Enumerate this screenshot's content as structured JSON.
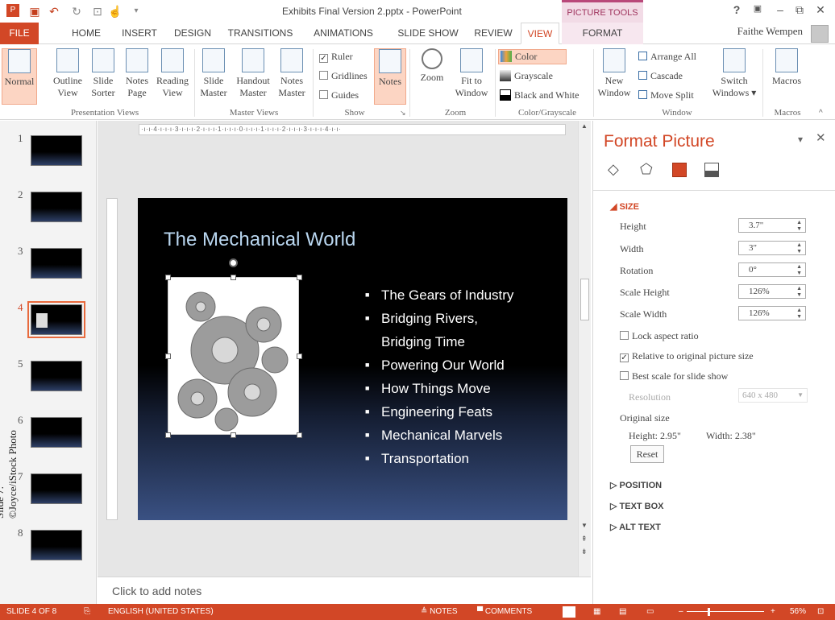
{
  "window": {
    "title": "Exhibits Final Version 2.pptx - PowerPoint",
    "context_tab_group": "PICTURE TOOLS",
    "controls": [
      "?",
      "▣",
      "–",
      "⧉",
      "✕"
    ],
    "user": "Faithe Wempen"
  },
  "tabs": [
    "FILE",
    "HOME",
    "INSERT",
    "DESIGN",
    "TRANSITIONS",
    "ANIMATIONS",
    "SLIDE SHOW",
    "REVIEW",
    "VIEW",
    "FORMAT"
  ],
  "active_tab": "VIEW",
  "ribbon": {
    "presentation_views": {
      "label": "Presentation Views",
      "normal": "Normal",
      "outline": "Outline",
      "outline2": "View",
      "slide": "Slide",
      "slide2": "Sorter",
      "notes": "Notes",
      "notes2": "Page",
      "reading": "Reading",
      "reading2": "View"
    },
    "master_views": {
      "label": "Master Views",
      "slide": "Slide",
      "slide2": "Master",
      "handout": "Handout",
      "handout2": "Master",
      "notes": "Notes",
      "notes2": "Master"
    },
    "show": {
      "label": "Show",
      "ruler": "Ruler",
      "gridlines": "Gridlines",
      "guides": "Guides",
      "notes": "Notes",
      "ruler_checked": "✓"
    },
    "zoom": {
      "label": "Zoom",
      "zoom": "Zoom",
      "fit": "Fit to",
      "fit2": "Window"
    },
    "color": {
      "label": "Color/Grayscale",
      "color": "Color",
      "grayscale": "Grayscale",
      "bw": "Black and White"
    },
    "window": {
      "label": "Window",
      "new": "New",
      "new2": "Window",
      "arrange": "Arrange All",
      "cascade": "Cascade",
      "move_split": "Move Split",
      "switch": "Switch",
      "switch2": "Windows ▾"
    },
    "macros": {
      "label": "Macros",
      "macros": "Macros"
    }
  },
  "thumbnails": [
    "1",
    "2",
    "3",
    "4",
    "5",
    "6",
    "7",
    "8"
  ],
  "selected_slide": 4,
  "ruler_h": "·ı·ı·4·ı·ı·ı·3·ı·ı·ı·2·ı·ı·ı·1·ı·ı·ı·0·ı·ı·ı·1·ı·ı·ı·2·ı·ı·ı·3·ı·ı·ı·4·ı·ı·",
  "slide": {
    "title": "The Mechanical World",
    "bullets": [
      "The Gears of Industry",
      "Bridging Rivers, Bridging Time",
      "Powering Our World",
      "How Things Move",
      "Engineering Feats",
      "Mechanical Marvels",
      "Transportation"
    ]
  },
  "notes_placeholder": "Click to add notes",
  "pane": {
    "title": "Format Picture",
    "close": "✕",
    "menu": "▾",
    "size_section": "SIZE",
    "height_label": "Height",
    "height_value": "3.7\"",
    "width_label": "Width",
    "width_value": "3\"",
    "rotation_label": "Rotation",
    "rotation_value": "0°",
    "scale_height_label": "Scale Height",
    "scale_height_value": "126%",
    "scale_width_label": "Scale Width",
    "scale_width_value": "126%",
    "lock_aspect": "Lock aspect ratio",
    "relative": "Relative to original picture size",
    "relative_checked": "✓",
    "best_scale": "Best scale for slide show",
    "resolution_label": "Resolution",
    "resolution_value": "640 x 480",
    "original_size_label": "Original size",
    "original_height": "Height:  2.95\"",
    "original_width": "Width:  2.38\"",
    "reset": "Reset",
    "position": "POSITION",
    "text_box": "TEXT BOX",
    "alt_text": "ALT TEXT"
  },
  "status": {
    "slide": "SLIDE 4 OF 8",
    "language": "ENGLISH (UNITED STATES)",
    "notes": "≜ NOTES",
    "comments": "▀ COMMENTS",
    "zoom": "56%",
    "zoom_minus": "–",
    "zoom_plus": "+"
  },
  "side_credit": "Slide 7: ©Joyce/iStock Photo",
  "colors": {
    "accent": "#d24726",
    "pane_title": "#d24726",
    "slide_title": "#b9d6ef"
  }
}
